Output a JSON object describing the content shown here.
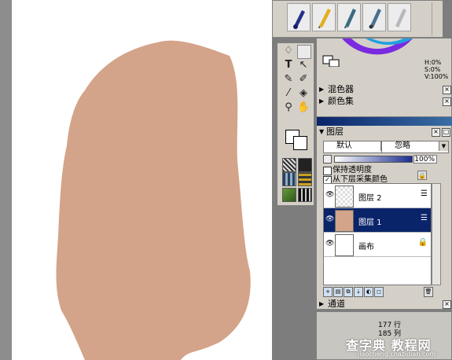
{
  "color_panel": {
    "hsv": [
      "H:0%",
      "S:0%",
      "V:100%"
    ],
    "sections": [
      {
        "label": "混色器"
      },
      {
        "label": "颜色集"
      }
    ]
  },
  "layers_panel": {
    "title": "图层",
    "blend_mode": "默认",
    "protect_mode": "忽略",
    "opacity": "100%",
    "preserve_transparency_label": "保持透明度",
    "sample_below_label": "从下层采集颜色",
    "layers": [
      {
        "name": "图层 2",
        "visible": true,
        "selected": false
      },
      {
        "name": "图层 1",
        "visible": true,
        "selected": true
      },
      {
        "name": "画布",
        "visible": true,
        "selected": false
      }
    ],
    "channel_label": "通道"
  },
  "info": {
    "rows": "177 行",
    "cols": "185 列"
  },
  "watermark": {
    "text": "查字典 教程网",
    "url": "jiaocheng.chazidian.com"
  },
  "colors": {
    "paint": "#d3a489",
    "selection": "#0a246a",
    "panel": "#d4d0c8"
  }
}
